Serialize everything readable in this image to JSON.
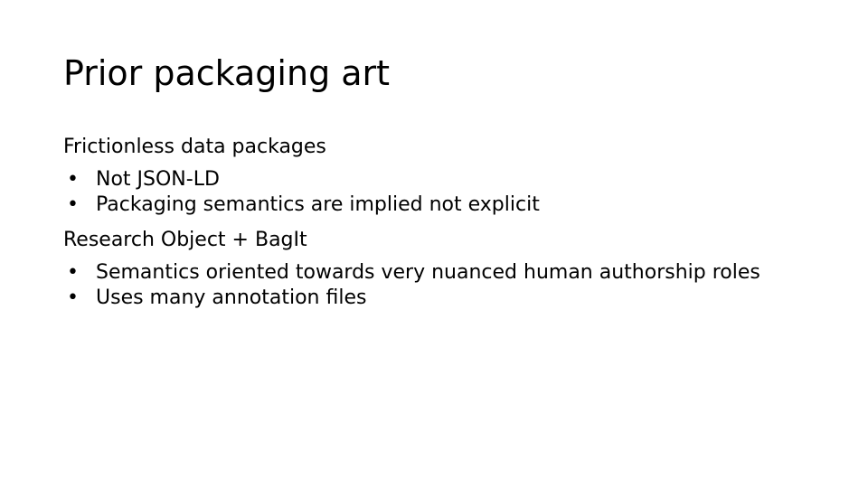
{
  "slide": {
    "title": "Prior packaging art",
    "sections": [
      {
        "heading": "Frictionless data packages",
        "bullets": [
          "Not JSON-LD",
          "Packaging semantics are implied not explicit"
        ]
      },
      {
        "heading": "Research Object + BagIt",
        "bullets": [
          "Semantics oriented towards very nuanced human authorship roles",
          "Uses many annotation files"
        ]
      }
    ],
    "bullet_glyph": "•"
  }
}
